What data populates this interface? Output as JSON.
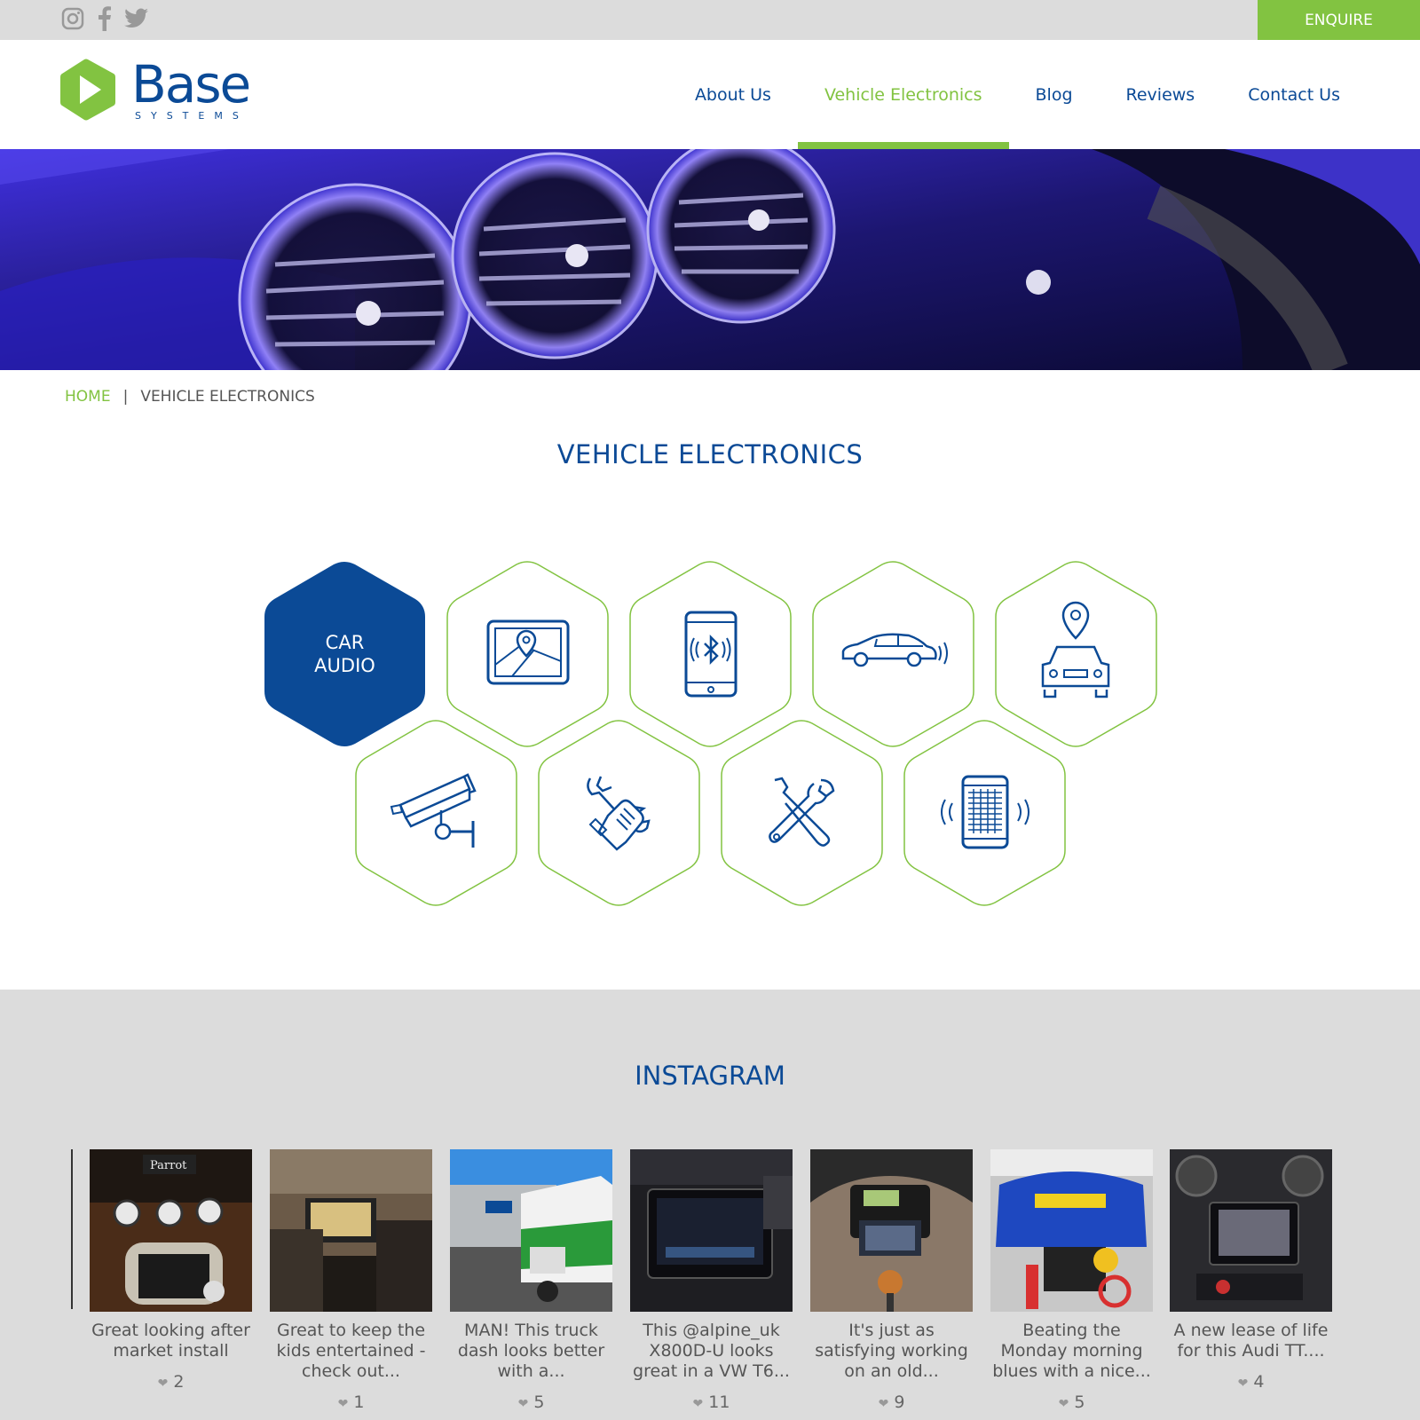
{
  "topbar": {
    "social": [
      "instagram-icon",
      "facebook-icon",
      "twitter-icon"
    ],
    "enquire_label": "ENQUIRE"
  },
  "brand": {
    "name": "Base",
    "sub": "SYSTEMS",
    "green": "#82c341",
    "blue": "#0b4a96"
  },
  "nav": {
    "items": [
      "About Us",
      "Vehicle Electronics",
      "Blog",
      "Reviews",
      "Contact Us"
    ],
    "active": "Vehicle Electronics"
  },
  "breadcrumb": {
    "home": "HOME",
    "separator": "|",
    "current": "VEHICLE ELECTRONICS"
  },
  "page_title": "VEHICLE ELECTRONICS",
  "categories": [
    {
      "label": "CAR\nAUDIO",
      "icon": "",
      "active": true
    },
    {
      "label": "",
      "icon": "gps-navigation-icon",
      "active": false
    },
    {
      "label": "",
      "icon": "bluetooth-phone-icon",
      "active": false
    },
    {
      "label": "",
      "icon": "car-sensor-icon",
      "active": false
    },
    {
      "label": "",
      "icon": "car-tracking-icon",
      "active": false
    },
    {
      "label": "",
      "icon": "cctv-camera-icon",
      "active": false
    },
    {
      "label": "",
      "icon": "hand-wrench-icon",
      "active": false
    },
    {
      "label": "",
      "icon": "tools-icon",
      "active": false
    },
    {
      "label": "",
      "icon": "phone-signal-icon",
      "active": false
    }
  ],
  "instagram": {
    "title": "INSTAGRAM",
    "posts": [
      {
        "caption": "Great looking after market install",
        "likes": "2"
      },
      {
        "caption": "Great to keep the kids entertained - check out...",
        "likes": "1"
      },
      {
        "caption": "MAN! This truck dash looks better with a...",
        "likes": "5"
      },
      {
        "caption": "This @alpine_uk X800D-U looks great in a VW T6...",
        "likes": "11"
      },
      {
        "caption": "It's just as satisfying working on an old...",
        "likes": "9"
      },
      {
        "caption": "Beating the Monday morning blues with a nice...",
        "likes": "5"
      },
      {
        "caption": "A new lease of life for this Audi TT....",
        "likes": "4"
      }
    ]
  }
}
